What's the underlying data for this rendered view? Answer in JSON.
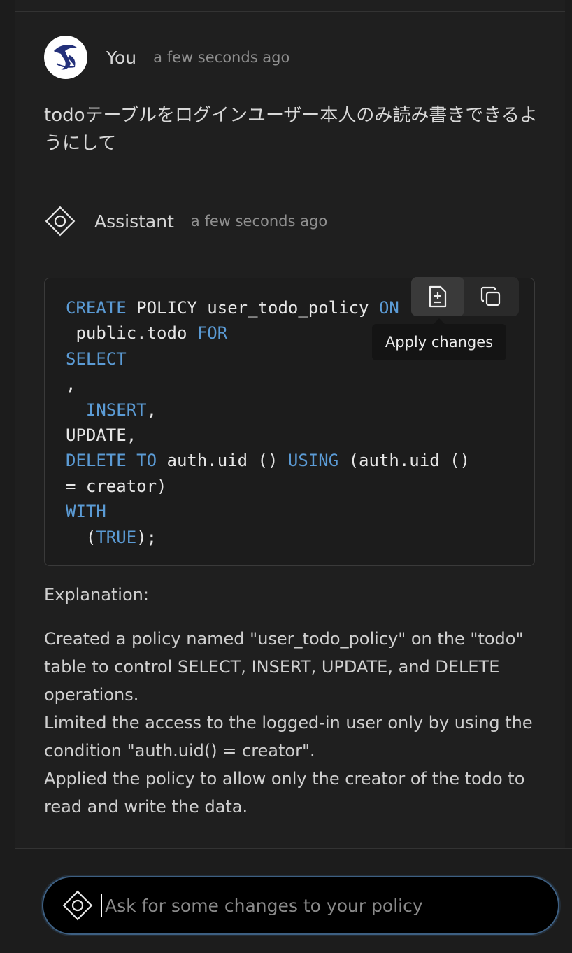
{
  "user_message": {
    "author": "You",
    "time": "a few seconds ago",
    "text": "todoテーブルをログインユーザー本人のみ読み書きできるようにして"
  },
  "assistant_message": {
    "author": "Assistant",
    "time": "a few seconds ago",
    "code": {
      "create": "CREATE",
      "policy_name": " POLICY user_todo_policy ",
      "on": "ON",
      "table": " public.todo ",
      "for": "FOR",
      "select": "SELECT",
      "comma": ",",
      "insert": "INSERT",
      "insert_comma": ",",
      "update": "UPDATE,",
      "delete": "DELETE",
      "to": "TO",
      "auth_uid": " auth.uid () ",
      "using": "USING",
      "using_expr": " (auth.uid ()",
      "eq_creator": "= creator)",
      "with": "WITH",
      "open_paren": "(",
      "true": "TRUE",
      "close": ");"
    },
    "toolbar": {
      "apply_icon": "file-diff-icon",
      "copy_icon": "copy-icon",
      "tooltip": "Apply changes"
    },
    "explanation_heading": "Explanation:",
    "explanation_lines": [
      "Created a policy named \"user_todo_policy\" on the \"todo\" table to control SELECT, INSERT, UPDATE, and DELETE operations.",
      "Limited the access to the logged-in user only by using the condition \"auth.uid() = creator\".",
      "Applied the policy to allow only the creator of the todo to read and write the data."
    ]
  },
  "composer": {
    "placeholder": "Ask for some changes to your policy",
    "value": "",
    "icon": "assistant-diamond-icon"
  },
  "colors": {
    "keyword": "#5b9bd5",
    "focus_border": "#3d5f82"
  }
}
